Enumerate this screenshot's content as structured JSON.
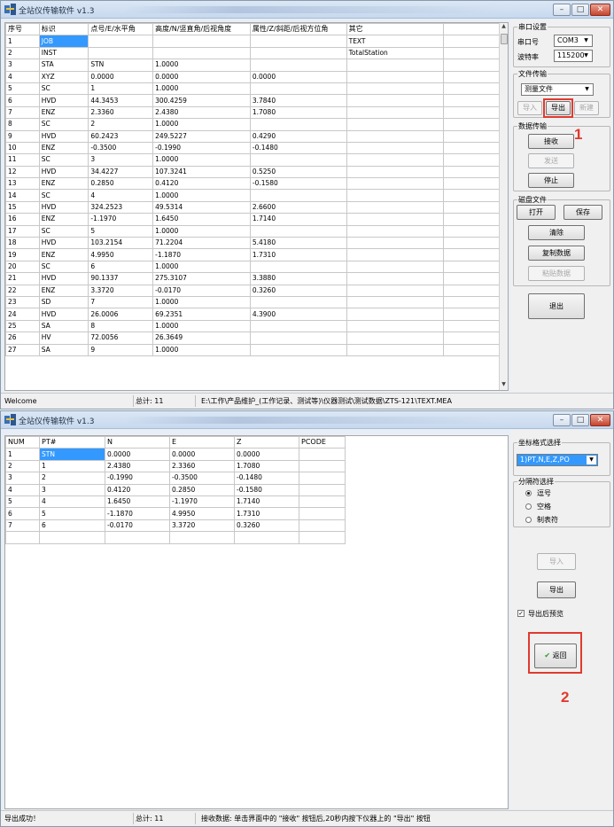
{
  "window1": {
    "title": "全站仪传输软件 v1.3",
    "columns": [
      "序号",
      "标识",
      "点号/E/水平角",
      "高度/N/竖直角/后视角度",
      "属性/Z/斜距/后视方位角",
      "其它"
    ],
    "rows": [
      [
        "1",
        "JOB",
        "",
        "",
        "",
        "TEXT"
      ],
      [
        "2",
        "INST",
        "",
        "",
        "",
        "TotalStation"
      ],
      [
        "3",
        "STA",
        "STN",
        "1.0000",
        "",
        ""
      ],
      [
        "4",
        "XYZ",
        "0.0000",
        "0.0000",
        "0.0000",
        ""
      ],
      [
        "5",
        "SC",
        "1",
        "1.0000",
        "",
        ""
      ],
      [
        "6",
        "HVD",
        "44.3453",
        "300.4259",
        "3.7840",
        ""
      ],
      [
        "7",
        "ENZ",
        "2.3360",
        "2.4380",
        "1.7080",
        ""
      ],
      [
        "8",
        "SC",
        "2",
        "1.0000",
        "",
        ""
      ],
      [
        "9",
        "HVD",
        "60.2423",
        "249.5227",
        "0.4290",
        ""
      ],
      [
        "10",
        "ENZ",
        "-0.3500",
        "-0.1990",
        "-0.1480",
        ""
      ],
      [
        "11",
        "SC",
        "3",
        "1.0000",
        "",
        ""
      ],
      [
        "12",
        "HVD",
        "34.4227",
        "107.3241",
        "0.5250",
        ""
      ],
      [
        "13",
        "ENZ",
        "0.2850",
        "0.4120",
        "-0.1580",
        ""
      ],
      [
        "14",
        "SC",
        "4",
        "1.0000",
        "",
        ""
      ],
      [
        "15",
        "HVD",
        "324.2523",
        "49.5314",
        "2.6600",
        ""
      ],
      [
        "16",
        "ENZ",
        "-1.1970",
        "1.6450",
        "1.7140",
        ""
      ],
      [
        "17",
        "SC",
        "5",
        "1.0000",
        "",
        ""
      ],
      [
        "18",
        "HVD",
        "103.2154",
        "71.2204",
        "5.4180",
        ""
      ],
      [
        "19",
        "ENZ",
        "4.9950",
        "-1.1870",
        "1.7310",
        ""
      ],
      [
        "20",
        "SC",
        "6",
        "1.0000",
        "",
        ""
      ],
      [
        "21",
        "HVD",
        "90.1337",
        "275.3107",
        "3.3880",
        ""
      ],
      [
        "22",
        "ENZ",
        "3.3720",
        "-0.0170",
        "0.3260",
        ""
      ],
      [
        "23",
        "SD",
        "7",
        "1.0000",
        "",
        ""
      ],
      [
        "24",
        "HVD",
        "26.0006",
        "69.2351",
        "4.3900",
        ""
      ],
      [
        "25",
        "SA",
        "8",
        "1.0000",
        "",
        ""
      ],
      [
        "26",
        "HV",
        "72.0056",
        "26.3649",
        "",
        ""
      ],
      [
        "27",
        "SA",
        "9",
        "1.0000",
        "",
        ""
      ]
    ],
    "serial_group": "串口设置",
    "port_label": "串口号",
    "port_value": "COM3",
    "baud_label": "波特率",
    "baud_value": "115200",
    "file_group": "文件传输",
    "file_type": "测量文件",
    "import_label": "导入",
    "export_label": "导出",
    "new_label": "新建",
    "data_group": "数据传输",
    "receive_label": "接收",
    "send_label": "发送",
    "stop_label": "停止",
    "disk_group": "磁盘文件",
    "open_label": "打开",
    "save_label": "保存",
    "clear_label": "清除",
    "copy_label": "复制数据",
    "paste_label": "粘贴数据",
    "exit_label": "退出",
    "annotation": "1",
    "status_left": "Welcome",
    "status_count": "总计: 11",
    "status_path": "E:\\工作\\产品维护_(工作记录、测试等)\\仪器测试\\测试数据\\ZTS-121\\TEXT.MEA"
  },
  "window2": {
    "title": "全站仪传输软件 v1.3",
    "columns": [
      "NUM",
      "PT#",
      "N",
      "E",
      "Z",
      "PCODE"
    ],
    "rows": [
      [
        "1",
        "STN",
        "0.0000",
        "0.0000",
        "0.0000",
        ""
      ],
      [
        "2",
        "1",
        "2.4380",
        "2.3360",
        "1.7080",
        ""
      ],
      [
        "3",
        "2",
        "-0.1990",
        "-0.3500",
        "-0.1480",
        ""
      ],
      [
        "4",
        "3",
        "0.4120",
        "0.2850",
        "-0.1580",
        ""
      ],
      [
        "5",
        "4",
        "1.6450",
        "-1.1970",
        "1.7140",
        ""
      ],
      [
        "6",
        "5",
        "-1.1870",
        "4.9950",
        "1.7310",
        ""
      ],
      [
        "7",
        "6",
        "-0.0170",
        "3.3720",
        "0.3260",
        ""
      ],
      [
        "",
        "",
        "",
        "",
        "",
        ""
      ]
    ],
    "coord_group": "坐标格式选择",
    "coord_format": "1)PT,N,E,Z,PO",
    "sep_group": "分隔符选择",
    "sep_comma": "逗号",
    "sep_space": "空格",
    "sep_tab": "制表符",
    "import_label": "导入",
    "export_label": "导出",
    "preview_label": "导出后预览",
    "back_label": "返回",
    "annotation": "2",
    "status_left": "导出成功！",
    "status_count": "总计: 11",
    "status_hint": "接收数据: 单击界面中的 \"接收\" 按钮后,20秒内按下仪器上的 \"导出\" 按钮"
  }
}
